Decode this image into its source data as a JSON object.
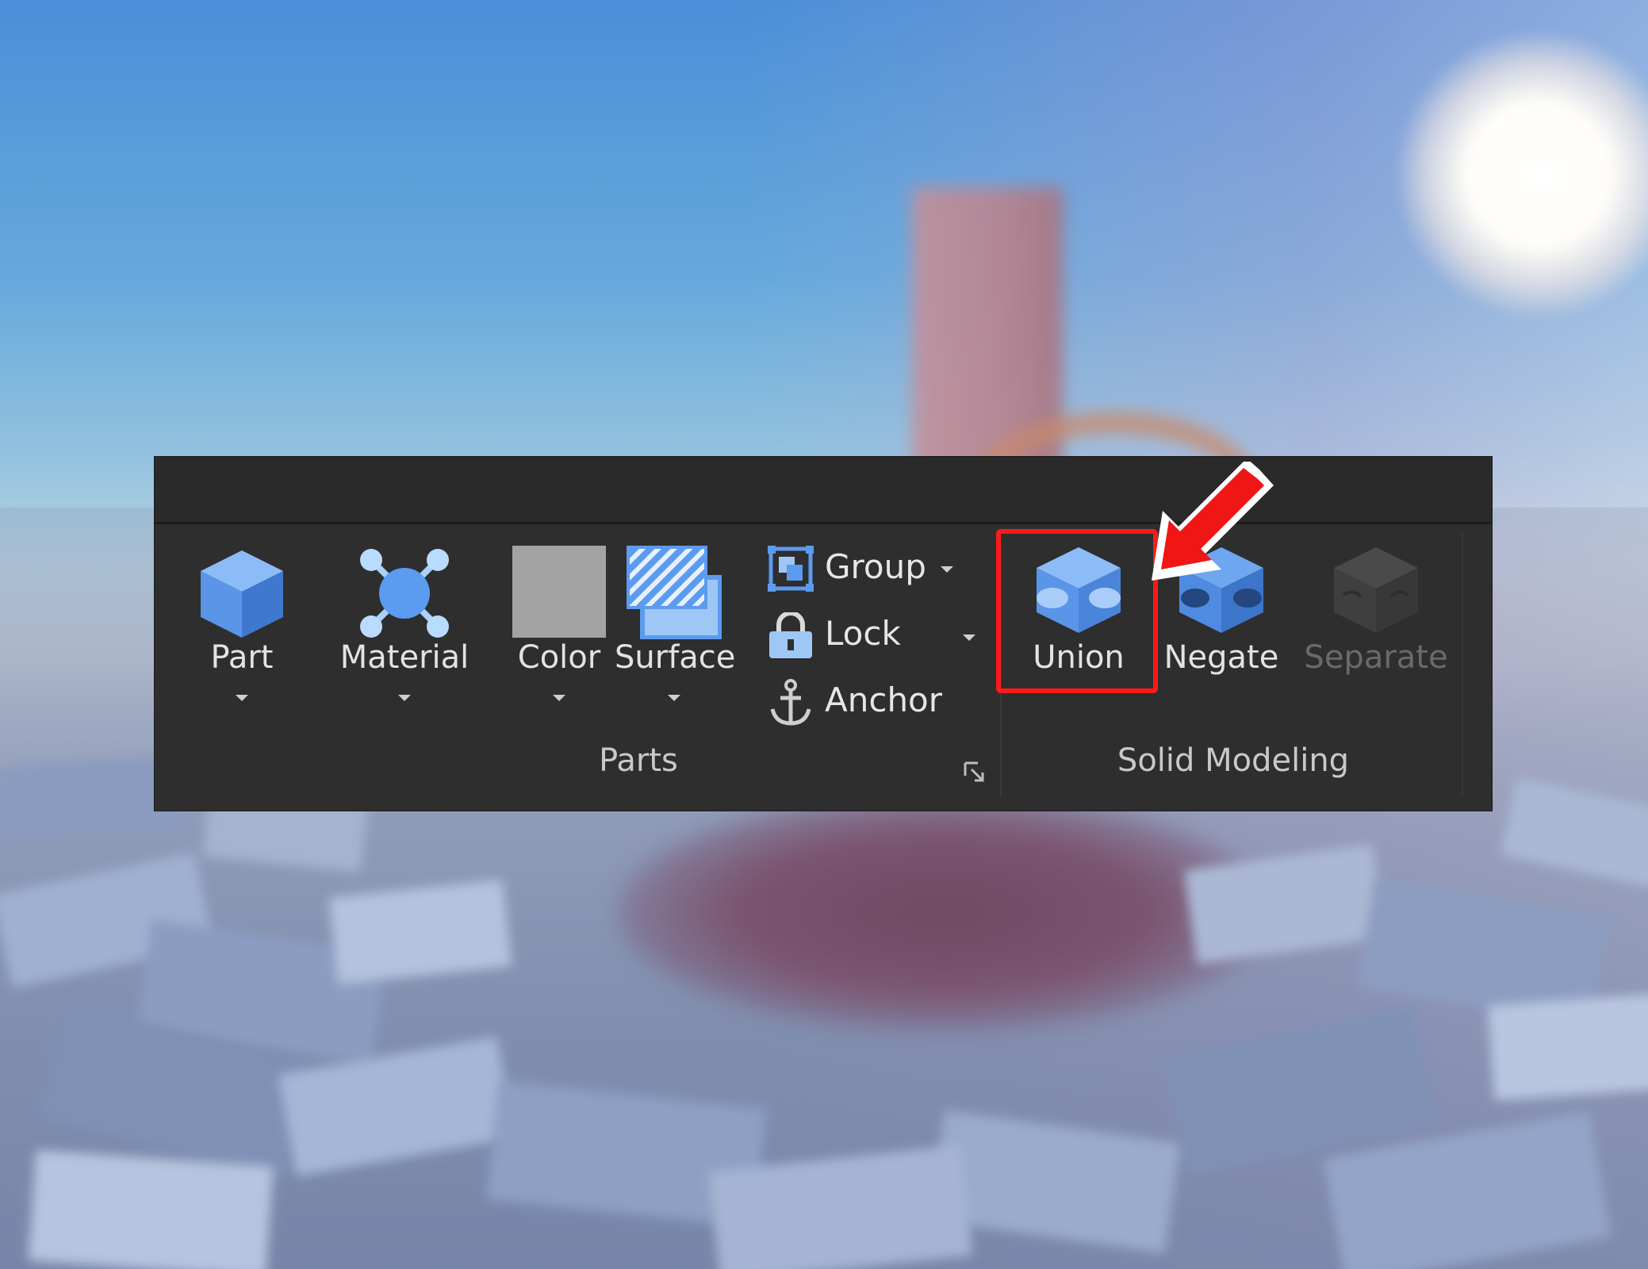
{
  "toolbar": {
    "groups": {
      "parts": {
        "label": "Parts"
      },
      "solid_modeling": {
        "label": "Solid Modeling"
      }
    },
    "parts_tools": [
      {
        "label": "Part",
        "icon": "part-cube-icon"
      },
      {
        "label": "Material",
        "icon": "material-molecule-icon"
      },
      {
        "label": "Color",
        "icon": "color-swatch-icon"
      },
      {
        "label": "Surface",
        "icon": "surface-hatched-icon"
      }
    ],
    "list_tools": [
      {
        "label": "Group",
        "icon": "group-icon",
        "has_dropdown": true
      },
      {
        "label": "Lock",
        "icon": "lock-icon",
        "has_dropdown": true
      },
      {
        "label": "Anchor",
        "icon": "anchor-icon",
        "has_dropdown": false
      }
    ],
    "solid_tools": [
      {
        "label": "Union",
        "icon": "union-icon",
        "enabled": true,
        "highlighted": true
      },
      {
        "label": "Negate",
        "icon": "negate-icon",
        "enabled": true
      },
      {
        "label": "Separate",
        "icon": "separate-icon",
        "enabled": false
      }
    ]
  },
  "colors": {
    "toolbar_bg": "#2e2e2e",
    "accent_blue": "#5b9bf0",
    "highlight_red": "#ff1a1a",
    "text": "#e3e3e3",
    "disabled_text": "#6a6a6a"
  }
}
